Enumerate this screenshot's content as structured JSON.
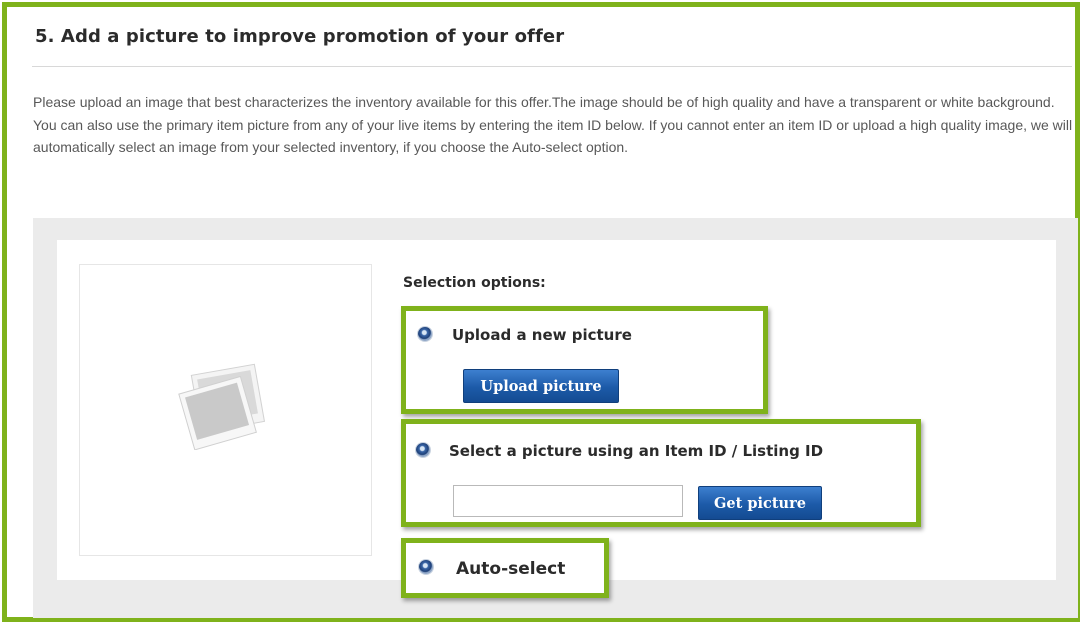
{
  "section": {
    "title": "5. Add a picture to improve promotion of your offer",
    "description": "Please upload an image that best characterizes the inventory available for this offer.The image should be of high quality and have a transparent or white background. You can also use the primary item picture from any of your live items by entering the item ID below. If you cannot enter an item ID or upload a high quality image, we will automatically select an image from your selected inventory, if you choose the Auto-select option."
  },
  "selection": {
    "heading": "Selection options:",
    "options": [
      {
        "label": "Upload a new picture",
        "button_label": "Upload picture",
        "selected": false
      },
      {
        "label": "Select a picture using an Item ID / Listing ID",
        "input_value": "",
        "input_placeholder": "",
        "button_label": "Get picture",
        "selected": false
      },
      {
        "label": "Auto-select",
        "selected": true
      }
    ]
  },
  "preview": {
    "icon": "photo-placeholder-icon"
  },
  "colors": {
    "highlight_green": "#7fb21b",
    "button_blue": "#1c5aa8",
    "panel_gray": "#ebebeb"
  }
}
